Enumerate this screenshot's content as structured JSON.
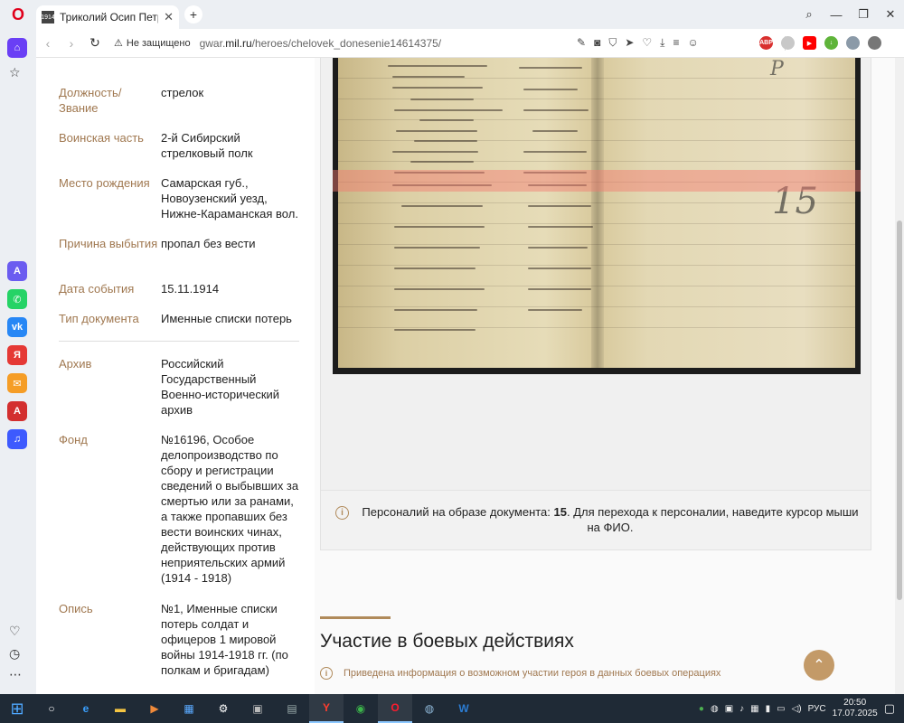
{
  "browser": {
    "tab_title": "Триколий Осип Петрови",
    "tab_favicon": "1914",
    "security_label": "Не защищено",
    "url_host_plain": "gwar.",
    "url_host_bold": "mil.ru",
    "url_path": "/heroes/chelovek_donesenie14614375/",
    "accent": "#e0001b"
  },
  "info": {
    "rows": [
      {
        "label": "Должность/ Звание",
        "value": "стрелок"
      },
      {
        "label": "Воинская часть",
        "value": "2-й Сибирский стрелковый полк"
      },
      {
        "label": "Место рождения",
        "value": "Самарская губ., Новоузенский уезд, Нижне-Караманская вол."
      },
      {
        "label": "Причина выбытия",
        "value": "пропал без вести"
      },
      {
        "label": "Дата события",
        "value": "15.11.1914"
      },
      {
        "label": "Тип документа",
        "value": "Именные списки потерь"
      },
      {
        "label": "Архив",
        "value": "Российский Государственный Военно-исторический архив"
      },
      {
        "label": "Фонд",
        "value": "№16196, Особое делопроизводство по сбору и регистрации сведений о выбывших за смертью или за ранами, а также пропавших без вести воинских чинах, действующих против неприятельских армий (1914 - 1918)"
      },
      {
        "label": "Опись",
        "value": "№1, Именные списки потерь солдат и офицеров 1 мировой войны 1914-1918 гг. (по полкам и бригадам)"
      }
    ]
  },
  "document": {
    "note_prefix": "Персоналий на образе документа: ",
    "note_count": "15",
    "note_suffix": ". Для перехода к персоналии, наведите курсор мыши на ФИО.",
    "handwritten_number": "15"
  },
  "section": {
    "title": "Участие в боевых действиях",
    "subnote": "Приведена информация о возможном участии героя в данных боевых операциях"
  },
  "taskbar": {
    "lang": "РУС",
    "time": "20:50",
    "date": "17.07.2025"
  }
}
